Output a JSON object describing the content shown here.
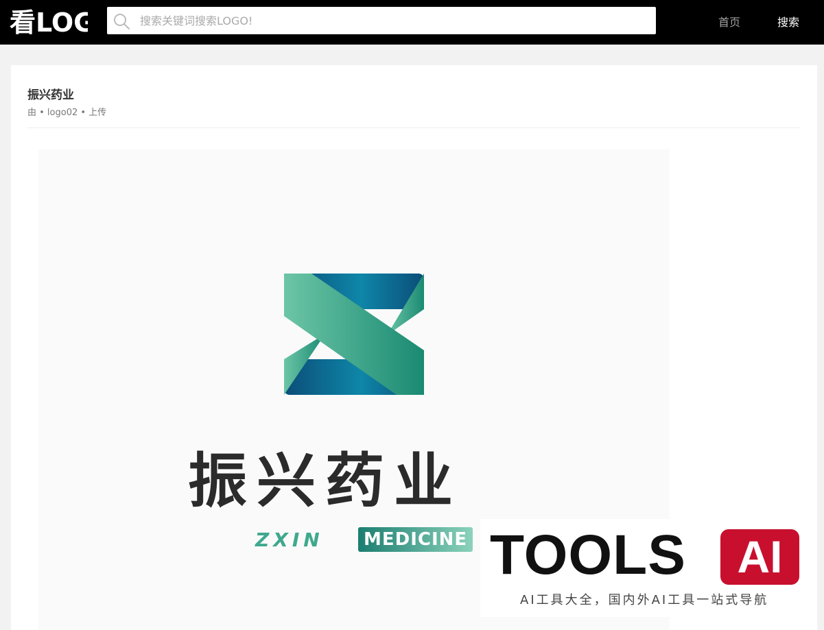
{
  "header": {
    "logo_text": "看LOGO",
    "search_placeholder": "搜索关键词搜索LOGO!",
    "nav": [
      {
        "label": "首页"
      },
      {
        "label": "搜索"
      }
    ]
  },
  "post": {
    "title": "振兴药业",
    "meta": "由 • logo02 • 上传"
  },
  "logo_image": {
    "name_cn": "振兴药业",
    "name_en_1": "ZXIN",
    "name_en_2": "MEDICINE",
    "colors": {
      "teal": "#3fa98d",
      "blue": "#0e5a86",
      "dark": "#2b2b2b"
    }
  },
  "watermark": {
    "title": "TOOLS",
    "badge": "AI",
    "subtitle": "AI工具大全，国内外AI工具一站式导航",
    "badge_color": "#c8102e"
  }
}
